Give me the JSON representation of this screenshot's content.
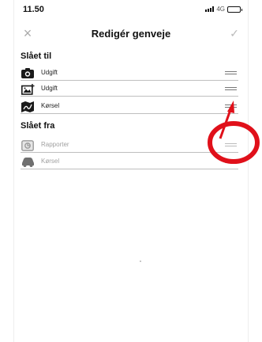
{
  "status_bar": {
    "time": "11.50",
    "network": "4G"
  },
  "nav": {
    "title": "Redigér genveje",
    "close_icon": "×",
    "confirm_icon": "✓"
  },
  "enabled_section": {
    "title": "Slået til",
    "items": [
      {
        "label": "Udgift",
        "icon": "camera-icon"
      },
      {
        "label": "Udgift",
        "icon": "image-add-icon"
      },
      {
        "label": "Kørsel",
        "icon": "map-icon"
      }
    ]
  },
  "disabled_section": {
    "title": "Slået fra",
    "items": [
      {
        "label": "Rapporter",
        "icon": "report-icon"
      },
      {
        "label": "Kørsel",
        "icon": "car-icon"
      }
    ]
  },
  "colors": {
    "annotation": "#e0101a",
    "disabled_text": "#a0a0a0"
  }
}
